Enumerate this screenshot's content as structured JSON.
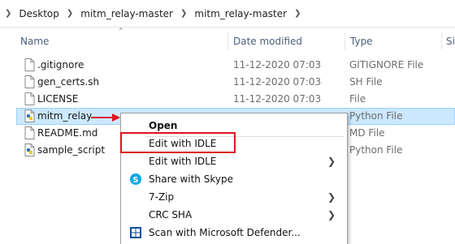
{
  "breadcrumb": {
    "items": [
      "Desktop",
      "mitm_relay-master",
      "mitm_relay-master"
    ]
  },
  "columns": {
    "name": "Name",
    "date_modified": "Date modified",
    "type": "Type",
    "size": "Si"
  },
  "files": [
    {
      "name": ".gitignore",
      "date": "11-12-2020 07:03",
      "type": "GITIGNORE File",
      "icon": "generic-file-icon"
    },
    {
      "name": "gen_certs.sh",
      "date": "11-12-2020 07:03",
      "type": "SH File",
      "icon": "generic-file-icon"
    },
    {
      "name": "LICENSE",
      "date": "11-12-2020 07:03",
      "type": "File",
      "icon": "generic-file-icon"
    },
    {
      "name": "mitm_relay",
      "date": "",
      "type": "Python File",
      "icon": "python-file-icon",
      "selected": true
    },
    {
      "name": "README.md",
      "date": "",
      "type": "MD File",
      "icon": "generic-file-icon"
    },
    {
      "name": "sample_script",
      "date": "",
      "type": "Python File",
      "icon": "python-file-icon"
    }
  ],
  "context_menu": {
    "open": "Open",
    "edit_idle_1": "Edit with IDLE",
    "edit_idle_2": "Edit with IDLE",
    "share_skype": "Share with Skype",
    "zip": "7-Zip",
    "crc": "CRC SHA",
    "defender": "Scan with Microsoft Defender..."
  },
  "colors": {
    "selection_bg": "#cce8ff",
    "selection_border": "#99d1ff",
    "highlight_red": "#e0141e"
  }
}
